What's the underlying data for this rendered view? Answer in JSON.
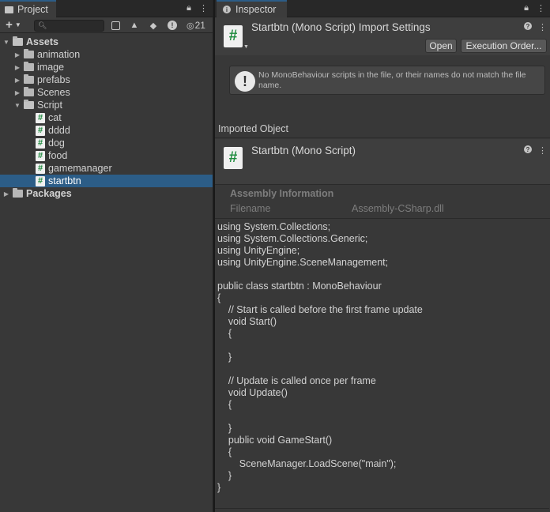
{
  "project_panel": {
    "tab_label": "Project",
    "hidden_count": "21",
    "search": {
      "value": "",
      "placeholder": ""
    },
    "tree": {
      "assets_label": "Assets",
      "folders": [
        {
          "label": "animation"
        },
        {
          "label": "image"
        },
        {
          "label": "prefabs"
        },
        {
          "label": "Scenes"
        }
      ],
      "script_folder_label": "Script",
      "scripts": [
        {
          "label": "cat"
        },
        {
          "label": "dddd"
        },
        {
          "label": "dog"
        },
        {
          "label": "food"
        },
        {
          "label": "gamemanager"
        },
        {
          "label": "startbtn",
          "selected": true
        }
      ],
      "packages_label": "Packages"
    }
  },
  "inspector": {
    "tab_label": "Inspector",
    "import_settings_title": "Startbtn (Mono Script) Import Settings",
    "open_button": "Open",
    "execution_order_button": "Execution Order...",
    "warning_text": "No MonoBehaviour scripts in the file, or their names do not match the file name.",
    "imported_object_label": "Imported Object",
    "object_title": "Startbtn (Mono Script)",
    "assembly": {
      "title": "Assembly Information",
      "filename_label": "Filename",
      "filename_value": "Assembly-CSharp.dll"
    },
    "code_lines": [
      "using System.Collections;",
      "using System.Collections.Generic;",
      "using UnityEngine;",
      "using UnityEngine.SceneManagement;",
      "",
      "public class startbtn : MonoBehaviour",
      "{",
      "    // Start is called before the first frame update",
      "    void Start()",
      "    {",
      "",
      "    }",
      "",
      "    // Update is called once per frame",
      "    void Update()",
      "    {",
      "",
      "    }",
      "    public void GameStart()",
      "    {",
      "        SceneManager.LoadScene(\"main\");",
      "    }",
      "}"
    ]
  },
  "icons": {
    "folder": "folder-icon",
    "script": "csharp-script-icon",
    "lock": "lock-icon",
    "menu": "kebab-menu-icon",
    "help": "help-icon",
    "warning": "exclamation-icon"
  }
}
